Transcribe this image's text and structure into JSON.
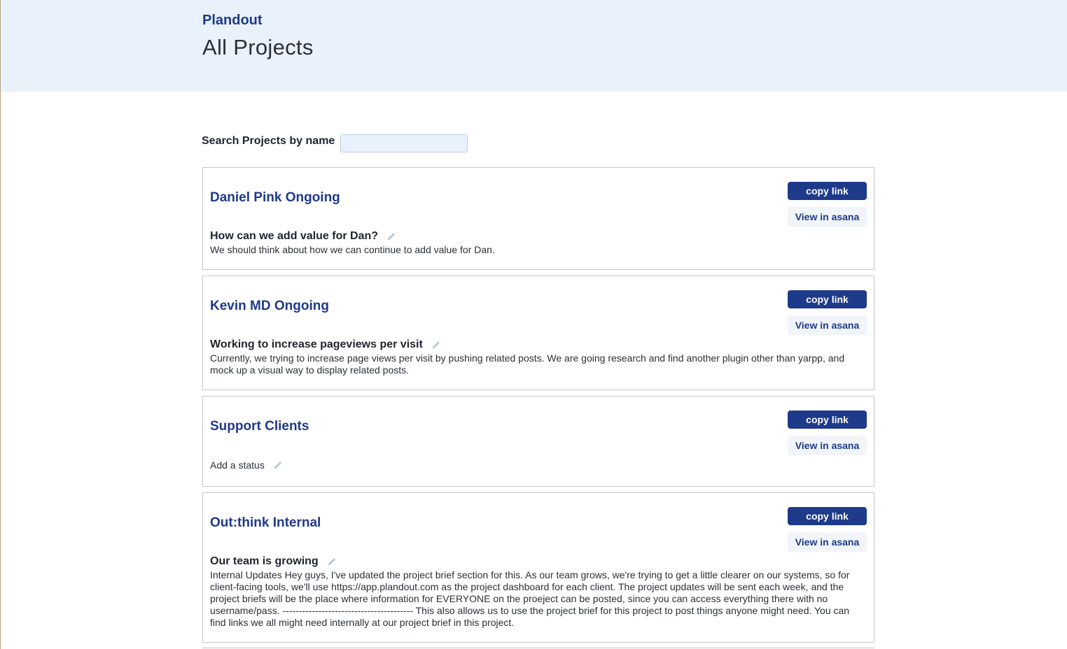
{
  "header": {
    "brand": "Plandout",
    "title": "All Projects"
  },
  "search": {
    "label": "Search Projects by name",
    "value": "",
    "placeholder": ""
  },
  "buttons": {
    "copy_link": "copy link",
    "view_asana": "View in asana"
  },
  "projects": [
    {
      "name": "Daniel Pink Ongoing",
      "status_title": "How can we add value for Dan?",
      "status_body": "We should think about how we can continue to add value for Dan."
    },
    {
      "name": "Kevin MD Ongoing",
      "status_title": "Working to increase pageviews per visit",
      "status_body": "Currently, we trying to increase page views per visit by pushing related posts. We are going research and find another plugin other than yarpp, and mock up a visual way to display related posts."
    },
    {
      "name": "Support Clients",
      "status_add": "Add a status"
    },
    {
      "name": "Out:think Internal",
      "status_title": "Our team is growing",
      "status_body": "Internal Updates Hey guys, I've updated the project brief section for this. As our team grows, we're trying to get a little clearer on our systems, so for client-facing tools, we'll use https://app.plandout.com as the project dashboard for each client. The project updates will be sent each week, and the project briefs will be the place where information for EVERYONE on the proeject can be posted, since you can access everything there with no username/pass. ---------------------------------------- This also allows us to use the project brief for this project to post things anyone might need. You can find links we all might need internally at our project brief in this project."
    }
  ],
  "colors": {
    "brand": "#1e3a8a",
    "header_bg": "#e9f1fb",
    "button_secondary_bg": "#f1f4f9"
  },
  "icons": {
    "edit": "pencil-icon"
  }
}
